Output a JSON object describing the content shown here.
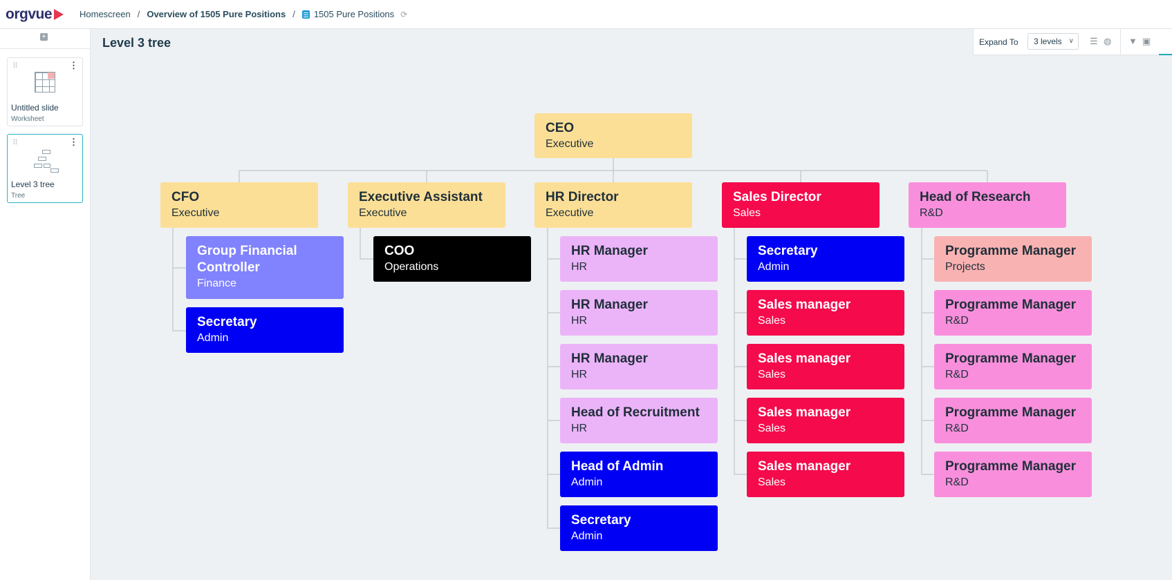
{
  "app": {
    "logo": "orgvue"
  },
  "breadcrumbs": {
    "home": "Homescreen",
    "overview": "Overview of 1505 Pure Positions",
    "dataset": "1505 Pure Positions",
    "separator": "/"
  },
  "sidebar": {
    "add_icon": "plus-icon",
    "slides": [
      {
        "name": "Untitled slide",
        "type": "Worksheet"
      },
      {
        "name": "Level 3 tree",
        "type": "Tree"
      }
    ]
  },
  "page": {
    "title": "Level 3 tree"
  },
  "toolbar": {
    "expand_label": "Expand To",
    "expand_value": "3 levels"
  },
  "colors": {
    "executive": "#fbdf96",
    "sales": "#f50a4c",
    "rnd": "#f98fdc",
    "finance": "#8082fe",
    "admin": "#0000f5",
    "operations": "#000000",
    "hr": "#ecb4f8",
    "projects": "#f9b2b2",
    "accent": "#21a9b8"
  },
  "tree": {
    "root": {
      "title": "CEO",
      "subtitle": "Executive"
    },
    "level2": [
      {
        "title": "CFO",
        "subtitle": "Executive"
      },
      {
        "title": "Executive Assistant",
        "subtitle": "Executive"
      },
      {
        "title": "HR Director",
        "subtitle": "Executive"
      },
      {
        "title": "Sales Director",
        "subtitle": "Sales"
      },
      {
        "title": "Head of Research",
        "subtitle": "R&D"
      }
    ],
    "cfo_children": [
      {
        "title": "Group Financial Controller",
        "subtitle": "Finance"
      },
      {
        "title": "Secretary",
        "subtitle": "Admin"
      }
    ],
    "ea_children": [
      {
        "title": "COO",
        "subtitle": "Operations"
      }
    ],
    "hr_children": [
      {
        "title": "HR Manager",
        "subtitle": "HR"
      },
      {
        "title": "HR Manager",
        "subtitle": "HR"
      },
      {
        "title": "HR Manager",
        "subtitle": "HR"
      },
      {
        "title": "Head of Recruitment",
        "subtitle": "HR"
      },
      {
        "title": "Head of Admin",
        "subtitle": "Admin"
      },
      {
        "title": "Secretary",
        "subtitle": "Admin"
      }
    ],
    "sales_children": [
      {
        "title": "Secretary",
        "subtitle": "Admin"
      },
      {
        "title": "Sales manager",
        "subtitle": "Sales"
      },
      {
        "title": "Sales manager",
        "subtitle": "Sales"
      },
      {
        "title": "Sales manager",
        "subtitle": "Sales"
      },
      {
        "title": "Sales manager",
        "subtitle": "Sales"
      }
    ],
    "research_children": [
      {
        "title": "Programme Manager",
        "subtitle": "Projects"
      },
      {
        "title": "Programme Manager",
        "subtitle": "R&D"
      },
      {
        "title": "Programme Manager",
        "subtitle": "R&D"
      },
      {
        "title": "Programme Manager",
        "subtitle": "R&D"
      },
      {
        "title": "Programme Manager",
        "subtitle": "R&D"
      }
    ]
  }
}
